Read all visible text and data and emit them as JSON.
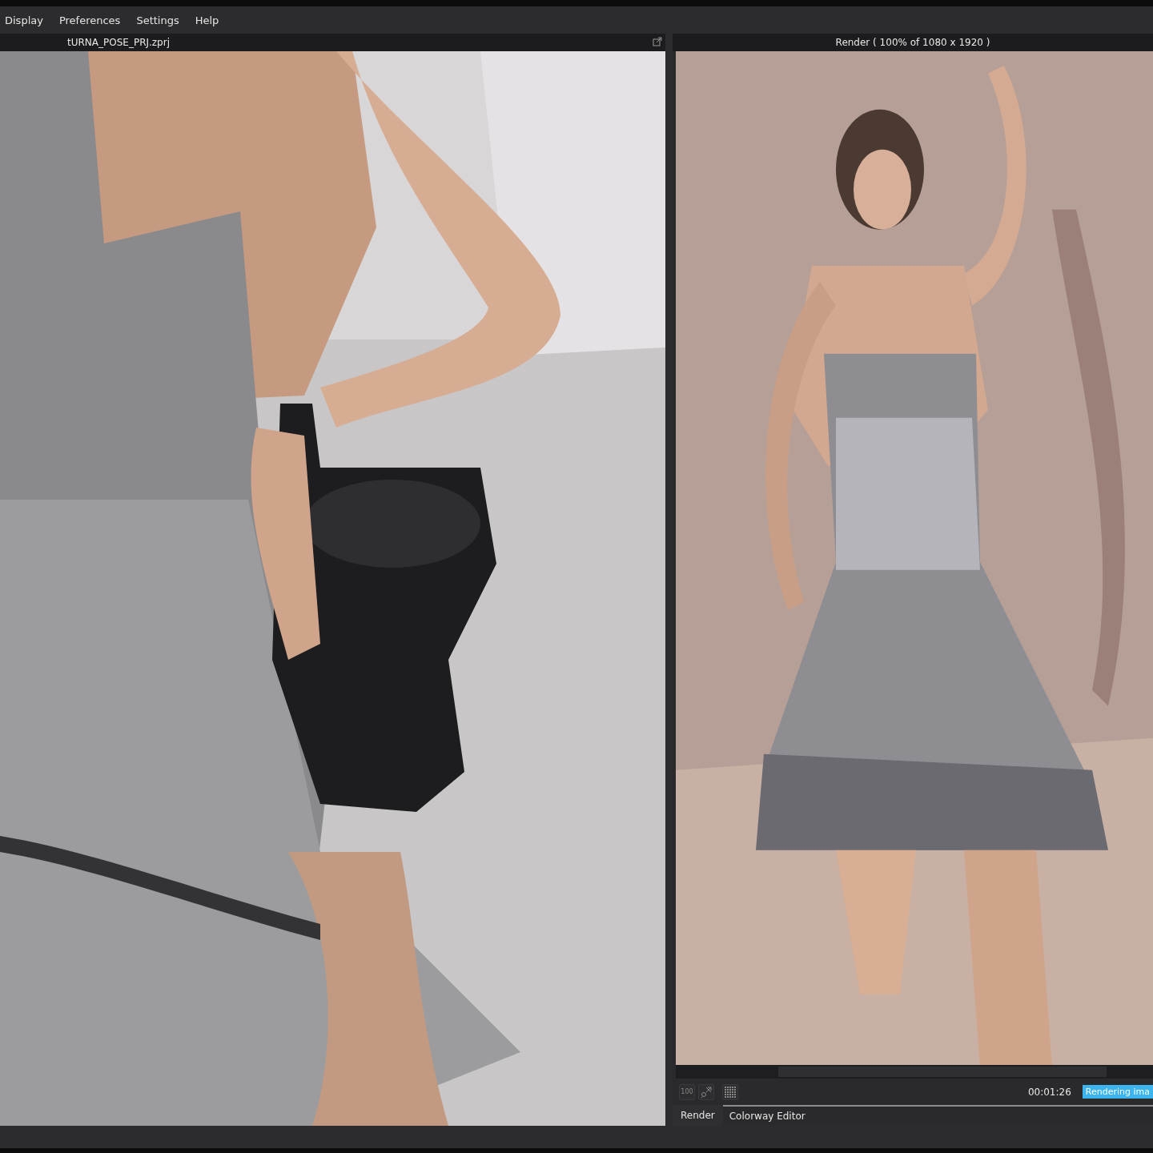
{
  "menu": [
    "Display",
    "Preferences",
    "Settings",
    "Help"
  ],
  "left_panel": {
    "title": "tURNA_POSE_PRJ.zprj"
  },
  "right_panel": {
    "title": "Render ( 100% of 1080 x 1920 )",
    "toolbar": {
      "zoom_label": "100",
      "time": "00:01:26",
      "status": "Rendering ima"
    },
    "tabs": [
      {
        "label": "Render",
        "selected": true
      },
      {
        "label": "Colorway Editor",
        "selected": false
      }
    ]
  }
}
